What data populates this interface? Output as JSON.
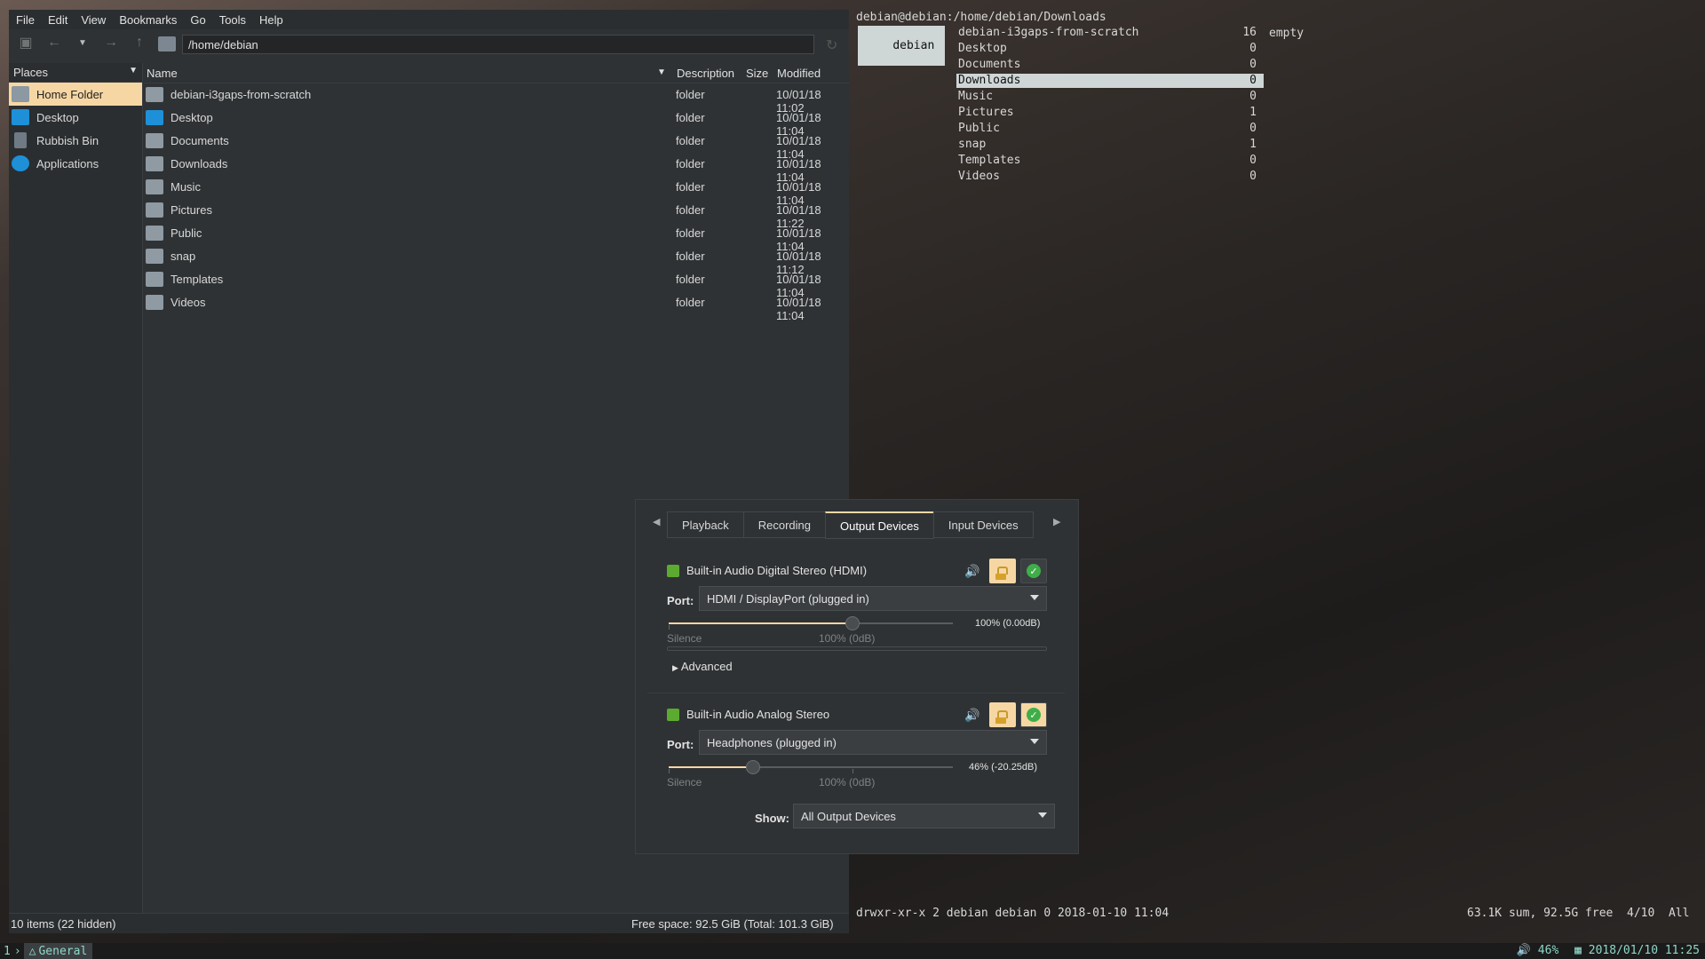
{
  "fm": {
    "menu": [
      "File",
      "Edit",
      "View",
      "Bookmarks",
      "Go",
      "Tools",
      "Help"
    ],
    "path": "/home/debian",
    "places_title": "Places",
    "places": [
      {
        "label": "Home Folder",
        "icon": "home-folder-icon",
        "selected": true
      },
      {
        "label": "Desktop",
        "icon": "desktop-icon",
        "selected": false
      },
      {
        "label": "Rubbish Bin",
        "icon": "trash-icon",
        "selected": false
      },
      {
        "label": "Applications",
        "icon": "applications-icon",
        "selected": false
      }
    ],
    "columns": {
      "name": "Name",
      "description": "Description",
      "size": "Size",
      "modified": "Modified"
    },
    "files": [
      {
        "name": "debian-i3gaps-from-scratch",
        "desc": "folder",
        "modified": "10/01/18 11:02"
      },
      {
        "name": "Desktop",
        "desc": "folder",
        "modified": "10/01/18 11:04"
      },
      {
        "name": "Documents",
        "desc": "folder",
        "modified": "10/01/18 11:04"
      },
      {
        "name": "Downloads",
        "desc": "folder",
        "modified": "10/01/18 11:04"
      },
      {
        "name": "Music",
        "desc": "folder",
        "modified": "10/01/18 11:04"
      },
      {
        "name": "Pictures",
        "desc": "folder",
        "modified": "10/01/18 11:22"
      },
      {
        "name": "Public",
        "desc": "folder",
        "modified": "10/01/18 11:04"
      },
      {
        "name": "snap",
        "desc": "folder",
        "modified": "10/01/18 11:12"
      },
      {
        "name": "Templates",
        "desc": "folder",
        "modified": "10/01/18 11:04"
      },
      {
        "name": "Videos",
        "desc": "folder",
        "modified": "10/01/18 11:04"
      }
    ],
    "status_left": "10 items (22 hidden)",
    "status_right": "Free space: 92.5 GiB (Total: 101.3 GiB)"
  },
  "term": {
    "title": "debian@debian:/home/debian/Downloads",
    "parent": "debian",
    "entries": [
      {
        "name": "debian-i3gaps-from-scratch",
        "count": "16"
      },
      {
        "name": "Desktop",
        "count": "0"
      },
      {
        "name": "Documents",
        "count": "0"
      },
      {
        "name": "Downloads",
        "count": "0"
      },
      {
        "name": "Music",
        "count": "0"
      },
      {
        "name": "Pictures",
        "count": "1"
      },
      {
        "name": "Public",
        "count": "0"
      },
      {
        "name": "snap",
        "count": "1"
      },
      {
        "name": "Templates",
        "count": "0"
      },
      {
        "name": "Videos",
        "count": "0"
      }
    ],
    "selected_index": 3,
    "preview": "empty",
    "status_left": "drwxr-xr-x 2 debian debian 0 2018-01-10 11:04",
    "status_right": "63.1K sum, 92.5G free  4/10  All"
  },
  "pav": {
    "tabs": [
      "Playback",
      "Recording",
      "Output Devices",
      "Input Devices"
    ],
    "active_tab": "Output Devices",
    "devices": [
      {
        "title": "Built-in Audio Digital Stereo (HDMI)",
        "port_label": "Port:",
        "port": "HDMI / DisplayPort (plugged in)",
        "volume_fraction": 1.0,
        "volume_text": "100% (0.00dB)",
        "silence": "Silence",
        "zero_db": "100% (0dB)",
        "advanced": "Advanced"
      },
      {
        "title": "Built-in Audio Analog Stereo",
        "port_label": "Port:",
        "port": "Headphones (plugged in)",
        "volume_fraction": 0.46,
        "volume_text": "46% (-20.25dB)",
        "silence": "Silence",
        "zero_db": "100% (0dB)"
      }
    ],
    "show_label": "Show:",
    "show_value": "All Output Devices"
  },
  "bar": {
    "workspace_num": "1",
    "workspace_sep": "›",
    "workspace_name": "General",
    "volume": "46%",
    "datetime": "2018/01/10 11:25"
  },
  "colors": {
    "accent": "#f6d7a4",
    "terminal_text": "#d8d8d8",
    "bar_text": "#8fd8c8"
  }
}
